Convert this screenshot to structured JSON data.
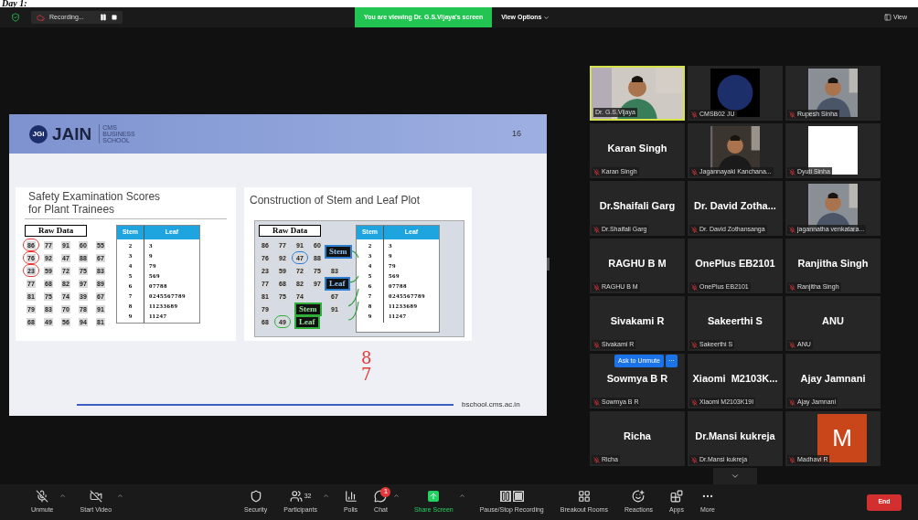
{
  "page_heading": "Day 1:",
  "top_bar": {
    "recording": "Recording...",
    "viewing_banner": "You are viewing Dr. G.S.Vijaya's screen",
    "view_options": "View Options",
    "view": "View"
  },
  "slide": {
    "logo_mark": "JGi",
    "brand": "JAIN",
    "school": [
      "CMS",
      "BUSINESS",
      "SCHOOL"
    ],
    "page_number": "16",
    "left": {
      "title": [
        "Safety Examination Scores",
        "for Plant Trainees"
      ],
      "raw_data_label": "Raw Data",
      "raw_data": [
        [
          {
            "text": "86",
            "circled": true,
            "color": "#e53935"
          },
          {
            "text": "77",
            "circled": false
          },
          {
            "text": "91",
            "circled": false
          },
          {
            "text": "60",
            "circled": false
          },
          {
            "text": "55",
            "circled": false
          }
        ],
        [
          {
            "text": "76",
            "circled": true,
            "color": "#e53935"
          },
          {
            "text": "92",
            "circled": false
          },
          {
            "text": "47",
            "circled": false
          },
          {
            "text": "88",
            "circled": false
          },
          {
            "text": "67",
            "circled": false
          }
        ],
        [
          {
            "text": "23",
            "circled": true,
            "color": "#e53935"
          },
          {
            "text": "59",
            "circled": false
          },
          {
            "text": "72",
            "circled": false
          },
          {
            "text": "75",
            "circled": false
          },
          {
            "text": "83",
            "circled": false
          }
        ],
        [
          {
            "text": "77",
            "circled": false
          },
          {
            "text": "68",
            "circled": false
          },
          {
            "text": "82",
            "circled": false
          },
          {
            "text": "97",
            "circled": false
          },
          {
            "text": "89",
            "circled": false
          }
        ],
        [
          {
            "text": "81",
            "circled": false
          },
          {
            "text": "75",
            "circled": false
          },
          {
            "text": "74",
            "circled": false
          },
          {
            "text": "39",
            "circled": false
          },
          {
            "text": "67",
            "circled": false
          }
        ],
        [
          {
            "text": "79",
            "circled": false
          },
          {
            "text": "83",
            "circled": false
          },
          {
            "text": "70",
            "circled": false
          },
          {
            "text": "78",
            "circled": false
          },
          {
            "text": "91",
            "circled": false
          }
        ],
        [
          {
            "text": "68",
            "circled": false
          },
          {
            "text": "49",
            "circled": false
          },
          {
            "text": "56",
            "circled": false
          },
          {
            "text": "94",
            "circled": false
          },
          {
            "text": "81",
            "circled": false
          }
        ]
      ],
      "table": {
        "columns": [
          "Stem",
          "Leaf"
        ],
        "rows": [
          [
            "2",
            "3"
          ],
          [
            "3",
            "9"
          ],
          [
            "4",
            "79"
          ],
          [
            "5",
            "569"
          ],
          [
            "6",
            "07788"
          ],
          [
            "7",
            "0245567789"
          ],
          [
            "8",
            "11233689"
          ],
          [
            "9",
            "11247"
          ]
        ]
      }
    },
    "right": {
      "title": "Construction of Stem and Leaf Plot",
      "raw_data_label": "Raw Data",
      "raw_data": [
        [
          {
            "kind": "number",
            "text": "86",
            "circled": false
          },
          {
            "kind": "number",
            "text": "77",
            "circled": false
          },
          {
            "kind": "number",
            "text": "91",
            "circled": false
          },
          {
            "kind": "number",
            "text": "60",
            "circled": false
          },
          {
            "kind": "blank"
          }
        ],
        [
          {
            "kind": "number",
            "text": "76",
            "circled": false
          },
          {
            "kind": "number",
            "text": "92",
            "circled": false
          },
          {
            "kind": "number",
            "text": "47",
            "circled": true,
            "color": "#2f7fd0"
          },
          {
            "kind": "number",
            "text": "88",
            "circled": false
          },
          {
            "kind": "blank"
          }
        ],
        [
          {
            "kind": "number",
            "text": "23",
            "circled": false
          },
          {
            "kind": "number",
            "text": "59",
            "circled": false
          },
          {
            "kind": "number",
            "text": "72",
            "circled": false
          },
          {
            "kind": "number",
            "text": "75",
            "circled": false
          },
          {
            "kind": "number",
            "text": "83",
            "circled": false
          }
        ],
        [
          {
            "kind": "number",
            "text": "77",
            "circled": false
          },
          {
            "kind": "number",
            "text": "68",
            "circled": false
          },
          {
            "kind": "number",
            "text": "82",
            "circled": false
          },
          {
            "kind": "number",
            "text": "97",
            "circled": false
          },
          {
            "kind": "blank"
          }
        ],
        [
          {
            "kind": "number",
            "text": "81",
            "circled": false
          },
          {
            "kind": "number",
            "text": "75",
            "circled": false
          },
          {
            "kind": "number",
            "text": "74",
            "circled": false
          },
          {
            "kind": "blank"
          },
          {
            "kind": "number",
            "text": "67",
            "circled": false
          }
        ],
        [
          {
            "kind": "number",
            "text": "79",
            "circled": false
          },
          {
            "kind": "blank"
          },
          {
            "kind": "blank"
          },
          {
            "kind": "blank"
          },
          {
            "kind": "number",
            "text": "91",
            "circled": false
          }
        ],
        [
          {
            "kind": "number",
            "text": "68",
            "circled": false
          },
          {
            "kind": "number",
            "text": "49",
            "circled": true,
            "color": "#2fae3a"
          },
          {
            "kind": "blank"
          },
          {
            "kind": "blank"
          },
          {
            "kind": "blank"
          }
        ]
      ],
      "labels": [
        {
          "text": "Stem",
          "color": "#2f7fd0"
        },
        {
          "text": "Leaf",
          "color": "#2f7fd0"
        },
        {
          "text": "Stem",
          "color": "#2fae3a"
        },
        {
          "text": "Leaf",
          "color": "#2fae3a"
        }
      ],
      "table": {
        "columns": [
          "Stem",
          "Leaf"
        ],
        "rows": [
          [
            "2",
            "3"
          ],
          [
            "3",
            "9"
          ],
          [
            "4",
            "79"
          ],
          [
            "5",
            "569"
          ],
          [
            "6",
            "07788"
          ],
          [
            "7",
            "0245567789"
          ],
          [
            "8",
            "11233689"
          ],
          [
            "9",
            "11247"
          ]
        ]
      }
    },
    "ink_notes": [
      "8",
      "7"
    ],
    "footer": "bschool.cms.ac.in"
  },
  "participants": [
    {
      "kind": "video",
      "name": "Dr. G.S.Vijaya",
      "muted": false,
      "active": true
    },
    {
      "kind": "video",
      "name": "CMSB02 JU",
      "muted": true,
      "active": false
    },
    {
      "kind": "video",
      "name": "Rupesh Sinha",
      "muted": true,
      "active": false
    },
    {
      "kind": "name",
      "display": "Karan Singh",
      "name": "Karan Singh",
      "muted": true,
      "active": false
    },
    {
      "kind": "video",
      "name": "Jagannayaki Kanchana...",
      "muted": true,
      "active": false
    },
    {
      "kind": "video",
      "name": "Dyuti Sinha",
      "muted": true,
      "active": false
    },
    {
      "kind": "name",
      "display": "Dr.Shaifali Garg",
      "name": "Dr.Shaifali Garg",
      "muted": true,
      "active": false
    },
    {
      "kind": "name",
      "display": "Dr. David Zotha...",
      "name": "Dr. David Zothansanga",
      "muted": true,
      "active": false
    },
    {
      "kind": "video",
      "name": "jagannatha venkatara...",
      "muted": true,
      "active": false
    },
    {
      "kind": "name",
      "display": "RAGHU B M",
      "name": "RAGHU B M",
      "muted": true,
      "active": false
    },
    {
      "kind": "name",
      "display": "OnePlus EB2101",
      "name": "OnePlus EB2101",
      "muted": true,
      "active": false
    },
    {
      "kind": "name",
      "display": "Ranjitha Singh",
      "name": "Ranjitha Singh",
      "muted": true,
      "active": false
    },
    {
      "kind": "name",
      "display": "Sivakami R",
      "name": "Sivakami R",
      "muted": true,
      "active": false
    },
    {
      "kind": "name",
      "display": "Sakeerthi S",
      "name": "Sakeerthi S",
      "muted": true,
      "active": false
    },
    {
      "kind": "name",
      "display": "ANU",
      "name": "ANU",
      "muted": true,
      "active": false
    },
    {
      "kind": "name",
      "display": "Sowmya B R",
      "name": "Sowmya B R",
      "muted": true,
      "active": false,
      "hover_actions": {
        "ask": "Ask to Unmute",
        "more": "···"
      }
    },
    {
      "kind": "name",
      "display": "Xiaomi  M2103K...",
      "name": "Xiaomi M2103K19I",
      "muted": true,
      "active": false
    },
    {
      "kind": "name",
      "display": "Ajay Jamnani",
      "name": "Ajay Jamnani",
      "muted": true,
      "active": false
    },
    {
      "kind": "name",
      "display": "Richa",
      "name": "Richa",
      "muted": true,
      "active": false
    },
    {
      "kind": "name",
      "display": "Dr.Mansi kukreja",
      "name": "Dr.Mansi kukreja",
      "muted": true,
      "active": false
    },
    {
      "kind": "avatar",
      "initial": "M",
      "color": "#c8461a",
      "name": "Madhavi R",
      "muted": true,
      "active": false
    }
  ],
  "toolbar": [
    {
      "kind": "mic",
      "label": "Unmute",
      "menu": true
    },
    {
      "kind": "camera",
      "label": "Start Video",
      "menu": true
    },
    {
      "kind": "security",
      "label": "Security",
      "menu": false
    },
    {
      "kind": "participants",
      "label": "Participants",
      "count": "32",
      "menu": true
    },
    {
      "kind": "polls",
      "label": "Polls",
      "menu": false
    },
    {
      "kind": "chat",
      "label": "Chat",
      "badge": "1",
      "menu": true
    },
    {
      "kind": "share",
      "label": "Share Screen",
      "menu": true
    },
    {
      "kind": "recording",
      "label": "Pause/Stop Recording",
      "menu": false
    },
    {
      "kind": "breakout",
      "label": "Breakout Rooms",
      "menu": false
    },
    {
      "kind": "reactions",
      "label": "Reactions",
      "menu": false
    },
    {
      "kind": "apps",
      "label": "Apps",
      "menu": false
    },
    {
      "kind": "more",
      "label": "More",
      "menu": false
    }
  ],
  "end_button": "End"
}
